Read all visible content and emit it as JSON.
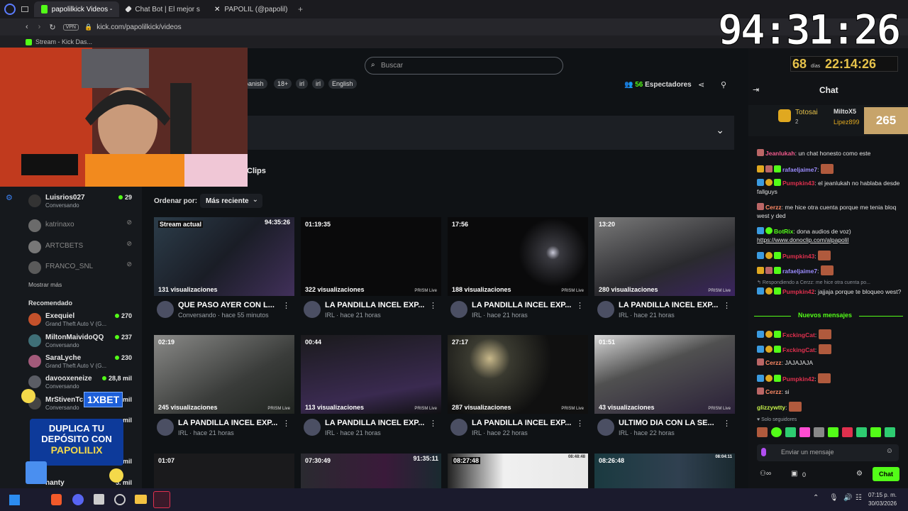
{
  "browser": {
    "tabs": [
      {
        "label": "papolilkick Videos - Watch",
        "active": true,
        "color": "#53fc18"
      },
      {
        "label": "Chat Bot | El mejor softwa",
        "active": false,
        "color": "#eeeeee"
      },
      {
        "label": "PAPOLIL (@papolil) / X",
        "active": false,
        "color": "#ffffff"
      }
    ],
    "vpn_badge": "VPN",
    "url": "kick.com/papolilkick/videos",
    "bookmark": "Stream - Kick Das..."
  },
  "overlay": {
    "timer": "94:31:26",
    "countdown_days": "68",
    "countdown_days_label": "días",
    "countdown_time": "22:14:26"
  },
  "header": {
    "search_placeholder": "Buscar",
    "tags": [
      "panish",
      "18+",
      "irl",
      "irl",
      "English"
    ],
    "viewers_count": "56",
    "viewers_label": "Espectadores"
  },
  "main": {
    "clips_tab": "Clips",
    "sort_label": "Ordenar por:",
    "sort_value": "Más reciente",
    "videos": [
      {
        "duration": "Stream actual",
        "corner_time": "94:35:26",
        "views": "131 visualizaciones",
        "title": "QUE PASO AYER CON L...",
        "meta": "Conversando · hace 55 minutos",
        "prism": ""
      },
      {
        "duration": "01:19:35",
        "views": "322 visualizaciones",
        "title": "LA PANDILLA INCEL EXP...",
        "meta": "IRL · hace 21 horas",
        "prism": "PRISM Live"
      },
      {
        "duration": "17:56",
        "views": "188 visualizaciones",
        "title": "LA PANDILLA INCEL EXP...",
        "meta": "IRL · hace 21 horas",
        "prism": "PRISM Live"
      },
      {
        "duration": "13:20",
        "views": "280 visualizaciones",
        "title": "LA PANDILLA INCEL EXP...",
        "meta": "IRL · hace 21 horas",
        "prism": "PRISM Live"
      },
      {
        "duration": "02:19",
        "views": "245 visualizaciones",
        "title": "LA PANDILLA INCEL EXP...",
        "meta": "IRL · hace 21 horas",
        "prism": "PRISM Live"
      },
      {
        "duration": "00:44",
        "views": "113 visualizaciones",
        "title": "LA PANDILLA INCEL EXP...",
        "meta": "IRL · hace 21 horas",
        "prism": "PRISM Live"
      },
      {
        "duration": "27:17",
        "views": "287 visualizaciones",
        "title": "LA PANDILLA INCEL EXP...",
        "meta": "IRL · hace 22 horas",
        "prism": "PRISM Live"
      },
      {
        "duration": "01:51",
        "views": "43 visualizaciones",
        "title": "ULTIMO DIA CON LA SE...",
        "meta": "IRL · hace 22 horas",
        "prism": "PRISM Live"
      }
    ],
    "row3_durations": [
      "01:07",
      "07:30:49",
      "08:27:48",
      "08:26:48"
    ],
    "row3_corner_times": [
      "",
      "91:35:11",
      "08:48:48",
      "08:04:11"
    ]
  },
  "sidebar": {
    "following": [
      {
        "name": "Luisrios027",
        "sub": "Conversando",
        "count": "29",
        "live": true
      },
      {
        "name": "katrinaxo",
        "sub": "",
        "count": "",
        "live": false
      },
      {
        "name": "ARTCBETS",
        "sub": "",
        "count": "",
        "live": false
      },
      {
        "name": "FRANCO_SNL",
        "sub": "",
        "count": "",
        "live": false
      }
    ],
    "show_more": "Mostrar más",
    "recommended_label": "Recomendado",
    "recommended": [
      {
        "name": "Exequiel",
        "sub": "Grand Theft Auto V (G...",
        "count": "270"
      },
      {
        "name": "MiltonMaividoQQ",
        "sub": "Conversando",
        "count": "237"
      },
      {
        "name": "SaraLyche",
        "sub": "Grand Theft Auto V (G...",
        "count": "230"
      },
      {
        "name": "davooxeneize",
        "sub": "Conversando",
        "count": "28,8 mil"
      },
      {
        "name": "MrStivenTc",
        "sub": "Conversando",
        "count": "mil"
      },
      {
        "name": "",
        "sub": "",
        "count": "mil"
      },
      {
        "name": "",
        "sub": "",
        "count": "mil"
      },
      {
        "name": "hanty",
        "sub": "",
        "count": "5. mil"
      }
    ],
    "ad_brand": "1XBET",
    "ad_line1": "DUPLICA TU",
    "ad_line2": "DEPÓSITO CON",
    "ad_line3": "PAPOLILIX"
  },
  "chat": {
    "title": "Chat",
    "leader1": "Totosai",
    "leader1_count": "2",
    "leader2": "MiltoX5",
    "leader3": "Lipez899",
    "sub_count": "265",
    "messages": [
      {
        "user": "Jeanlukah",
        "user_color": "#f05a8c",
        "text": " un chat honesto como este",
        "emote": false
      },
      {
        "user": "rafaeljaime7",
        "user_color": "#9b8cff",
        "text": "",
        "emote": true
      },
      {
        "user": "Pumpkin43",
        "user_color": "#e0304e",
        "text": " el jeanlukah no hablaba desde fallguys",
        "emote": false
      },
      {
        "user": "Cerzz",
        "user_color": "#ff8a65",
        "text": " me hice otra cuenta porque me tenia bloq west y ded",
        "emote": false
      },
      {
        "user": "BotRix",
        "user_color": "#53fc18",
        "text": " dona audios de voz)",
        "link": "https://www.donoclip.com/alpapolil",
        "emote": false
      },
      {
        "user": "Pumpkin43",
        "user_color": "#e0304e",
        "text": "",
        "emote": true
      },
      {
        "user": "rafaeljaime7",
        "user_color": "#9b8cff",
        "text": "",
        "emote": true
      },
      {
        "user": "Pumpkin42",
        "user_color": "#e0304e",
        "text": " jajjaja porque te bloqueo west?",
        "emote": false
      }
    ],
    "reply_note": "Respondiendo a Cerzz: me hice otra cuenta po...",
    "new_messages": "Nuevos mensajes",
    "messages2": [
      {
        "user": "FxckingCat",
        "user_color": "#e0304e",
        "text": "",
        "emote": true
      },
      {
        "user": "FxckingCat",
        "user_color": "#e0304e",
        "text": "",
        "emote": true
      },
      {
        "user": "Cerzz",
        "user_color": "#ff8a65",
        "text": " JAJAJAJA",
        "emote": false
      },
      {
        "user": "Pumpkin42",
        "user_color": "#e0304e",
        "text": "",
        "emote": true
      },
      {
        "user": "Cerzz",
        "user_color": "#ff8a65",
        "text": " si",
        "emote": false
      },
      {
        "user": "glizzywtty",
        "user_color": "#c6f14a",
        "text": "",
        "emote": true
      }
    ],
    "followers_only": "Solo seguidores",
    "input_placeholder": "Enviar un mensaje",
    "points": "0",
    "send_label": "Chat"
  },
  "taskbar": {
    "time": "07:15 p. m.",
    "date": "30/03/2026"
  },
  "colors": {
    "accent": "#53fc18",
    "bg": "#0f1215"
  }
}
